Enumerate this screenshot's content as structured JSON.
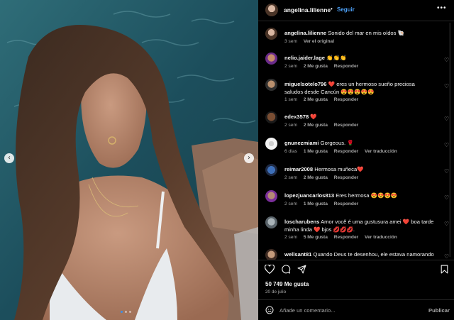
{
  "post": {
    "username": "angelina.lilienne",
    "follow_label": "Seguir",
    "more_icon": "more-horizontal-icon",
    "caption": {
      "username": "angelina.lilienne",
      "text": "Sonido del mar en mis oídos 🐚",
      "time": "3 sem",
      "translate": "Ver el original"
    },
    "likes": "50 749 Me gusta",
    "date": "20 de julio"
  },
  "comments": [
    {
      "username": "nelio.jaider.lage",
      "text": "👏👏👏",
      "time": "2 sem",
      "likes": "2 Me gusta",
      "reply": "Responder",
      "translate": ""
    },
    {
      "username": "miguelsotelo796",
      "text": "❤️ eres un hermoso sueño preciosa saludos desde Cancún 😍😍😍😍😍",
      "time": "1 sem",
      "likes": "2 Me gusta",
      "reply": "Responder",
      "translate": ""
    },
    {
      "username": "edex3578",
      "text": "❤️",
      "time": "2 sem",
      "likes": "2 Me gusta",
      "reply": "Responder",
      "translate": ""
    },
    {
      "username": "gnunezmiami",
      "text": "Gorgeous. 🌹",
      "time": "6 días",
      "likes": "1 Me gusta",
      "reply": "Responder",
      "translate": "Ver traducción"
    },
    {
      "username": "reimar2008",
      "text": "Hermosa muñeca❤️",
      "time": "2 sem",
      "likes": "2 Me gusta",
      "reply": "Responder",
      "translate": ""
    },
    {
      "username": "lopezjuancarlos813",
      "text": "Eres hermosa 😍😍😍😍",
      "time": "2 sem",
      "likes": "1 Me gusta",
      "reply": "Responder",
      "translate": ""
    },
    {
      "username": "loscharubens",
      "text": "Amor você é uma gustusura amei ❤️ boa tarde minha linda ❤️ bjos 💋💋💋.",
      "time": "2 sem",
      "likes": "5 Me gusta",
      "reply": "Responder",
      "translate": "Ver traducción"
    },
    {
      "username": "wellsant81",
      "text": "Quando Deus te desenhou, ele estava namorando",
      "time": "",
      "likes": "",
      "reply": "",
      "translate": ""
    }
  ],
  "composer": {
    "placeholder": "Añade un comentario...",
    "publish_label": "Publicar"
  },
  "media": {
    "prev_icon": "chevron-left-icon",
    "next_icon": "chevron-right-icon",
    "carousel_count": 3,
    "carousel_active": 1
  },
  "colors": {
    "background": "#000000",
    "link_blue": "#4c9ff5",
    "heart_red": "#ed4956",
    "muted": "#a8a8a8",
    "divider": "#262626"
  }
}
